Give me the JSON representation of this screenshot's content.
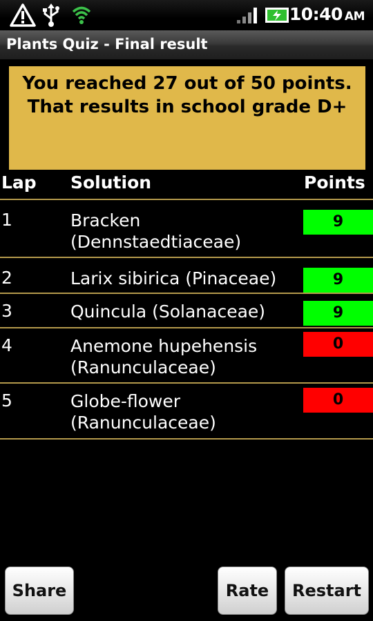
{
  "status_bar": {
    "time": "10:40",
    "ampm": "AM",
    "icons": [
      "warning-icon",
      "usb-icon",
      "wifi-icon",
      "signal-icon",
      "battery-charging-icon"
    ]
  },
  "title": "Plants Quiz - Final result",
  "result": {
    "line1": "You reached 27 out of 50 points.",
    "line2": "That results in school grade D+"
  },
  "table": {
    "headers": {
      "lap": "Lap",
      "solution": "Solution",
      "points": "Points"
    },
    "rows": [
      {
        "lap": "1",
        "solution": "Bracken (Dennstaedtiaceae)",
        "points": "9",
        "status": "correct"
      },
      {
        "lap": "2",
        "solution": "Larix sibirica (Pinaceae)",
        "points": "9",
        "status": "correct"
      },
      {
        "lap": "3",
        "solution": "Quincula (Solanaceae)",
        "points": "9",
        "status": "correct"
      },
      {
        "lap": "4",
        "solution": "Anemone hupehensis (Ranunculaceae)",
        "points": "0",
        "status": "wrong"
      },
      {
        "lap": "5",
        "solution": "Globe-flower (Ranunculaceae)",
        "points": "0",
        "status": "wrong"
      }
    ]
  },
  "buttons": {
    "share": "Share",
    "rate": "Rate",
    "restart": "Restart"
  },
  "colors": {
    "banner": "#e0b84a",
    "correct": "#00ff00",
    "wrong": "#ff0000",
    "rule": "#b59a4c"
  }
}
